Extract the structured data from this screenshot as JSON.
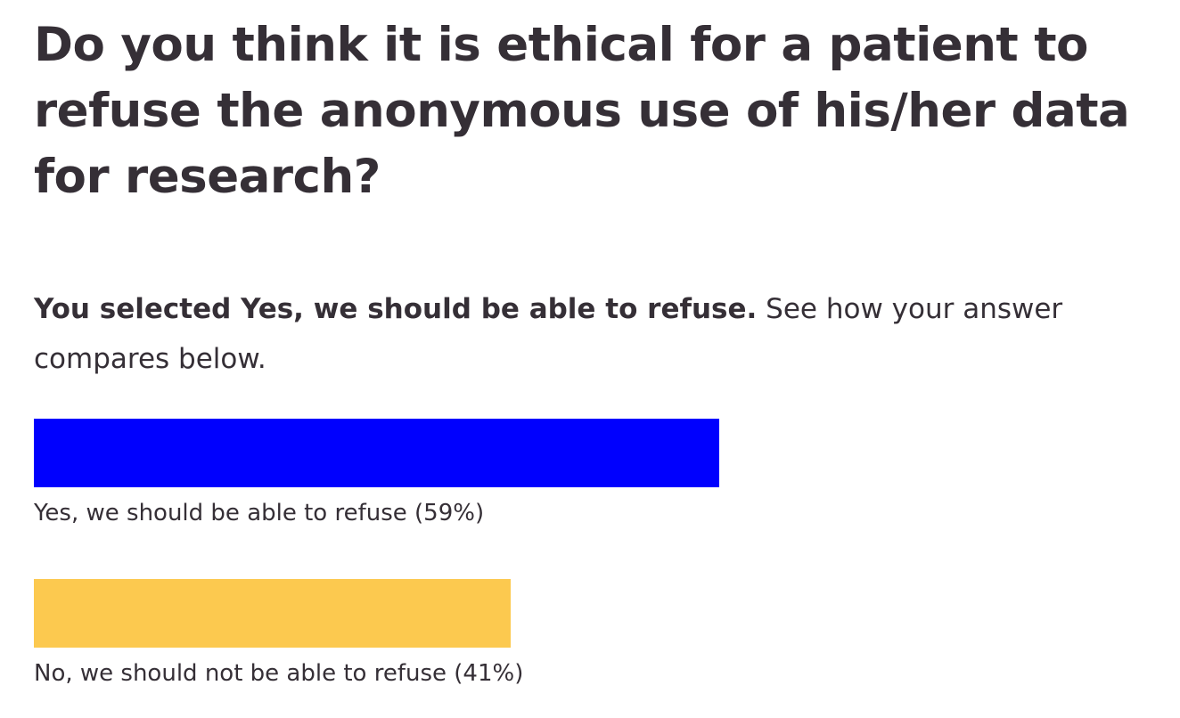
{
  "question": {
    "text": "Do you think it is ethical for a patient to refuse the anonymous use of his/her data for research?"
  },
  "selection": {
    "prefix": "You selected Yes, we should be able to refuse.",
    "suffix": " See how your answer compares below."
  },
  "results": [
    {
      "label": "Yes, we should be able to refuse (59%)",
      "percent": 59,
      "color": "#0000fe"
    },
    {
      "label": "No, we should not be able to refuse (41%)",
      "percent": 41,
      "color": "#fcc94f"
    }
  ]
}
